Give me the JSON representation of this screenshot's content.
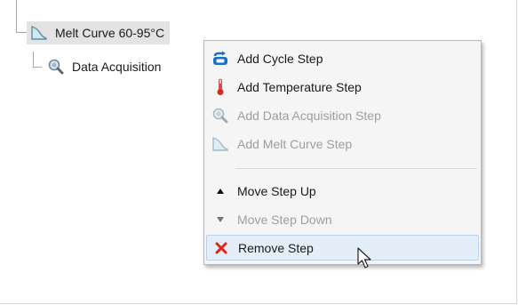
{
  "tree": {
    "melt_curve_node": {
      "label": "Melt Curve 60-95°C",
      "icon": "melt-curve-icon"
    },
    "data_acquisition_node": {
      "label": "Data Acquisition",
      "icon": "data-acquisition-icon"
    }
  },
  "context_menu": {
    "items": [
      {
        "label": "Add Cycle Step",
        "icon": "cycle-icon",
        "enabled": true
      },
      {
        "label": "Add Temperature Step",
        "icon": "thermometer-icon",
        "enabled": true
      },
      {
        "label": "Add Data Acquisition Step",
        "icon": "data-acquisition-icon",
        "enabled": false
      },
      {
        "label": "Add Melt Curve Step",
        "icon": "melt-curve-icon",
        "enabled": false
      },
      {
        "label": "Move Step Up",
        "icon": "arrow-up-icon",
        "enabled": true
      },
      {
        "label": "Move Step Down",
        "icon": "arrow-down-icon",
        "enabled": false
      },
      {
        "label": "Remove Step",
        "icon": "remove-x-icon",
        "enabled": true,
        "highlighted": true
      }
    ]
  },
  "colors": {
    "highlight_bg": "#e4eef9",
    "highlight_border": "#b9d3ee",
    "disabled_text": "#9e9e9e",
    "remove_red": "#e0241b",
    "cycle_blue": "#1f6fc0"
  }
}
